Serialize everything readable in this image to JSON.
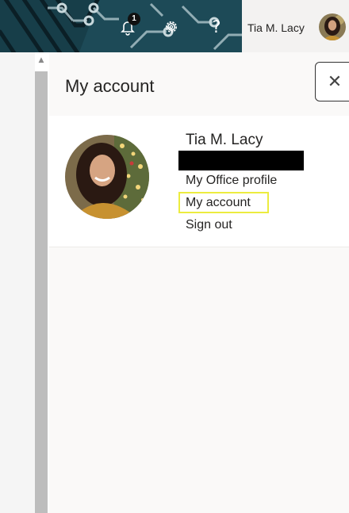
{
  "header": {
    "notification_count": "1",
    "help_label": "?",
    "user_name": "Tia M. Lacy",
    "colors": {
      "bar": "#1d4a57",
      "right": "#f3f2f1"
    },
    "icons": [
      "bell-icon",
      "gear-icon",
      "help-icon"
    ]
  },
  "panel": {
    "title": "My account",
    "close_label": "✕",
    "user_name": "Tia M. Lacy",
    "links": {
      "office_profile": "My Office profile",
      "my_account": "My account",
      "sign_out": "Sign out"
    },
    "highlight_color": "#ecec3f"
  }
}
